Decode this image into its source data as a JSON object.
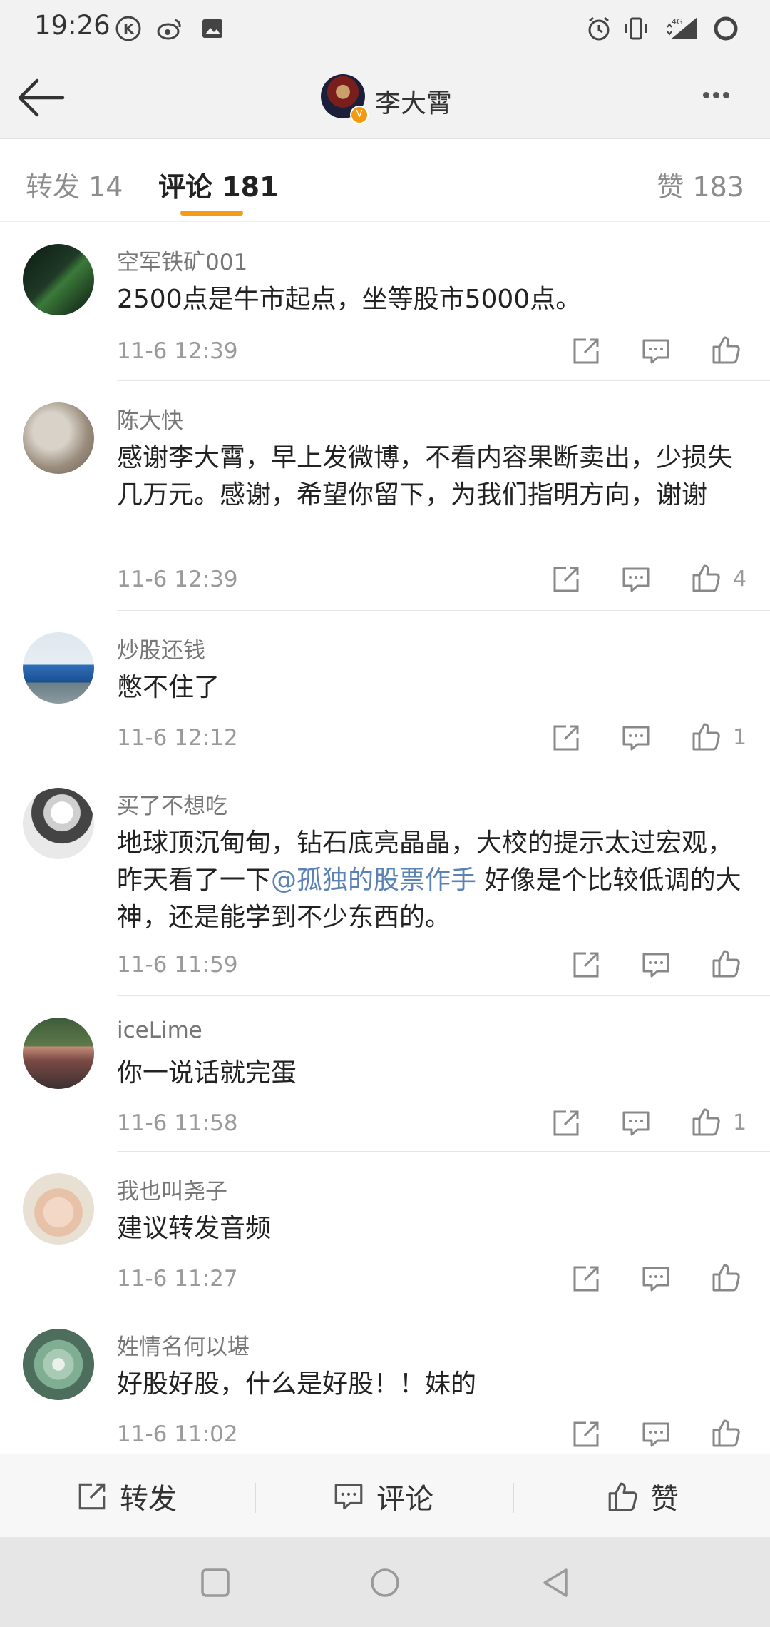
{
  "status_bar": {
    "time": "19:26",
    "network": "4G"
  },
  "header": {
    "title": "李大霄"
  },
  "tabs": [
    {
      "label": "转发 14"
    },
    {
      "label": "评论 181"
    },
    {
      "label": "赞 183"
    }
  ],
  "comments": [
    {
      "user": "空军铁矿001",
      "text": "2500点是牛市起点，坐等股市5000点。",
      "time": "11-6 12:39",
      "likes": ""
    },
    {
      "user": "陈大快",
      "text": "感谢李大霄，早上发微博，不看内容果断卖出，少损失几万元。感谢，希望你留下，为我们指明方向，谢谢",
      "time": "11-6 12:39",
      "likes": "4"
    },
    {
      "user": "炒股还钱",
      "text": "憋不住了",
      "time": "11-6 12:12",
      "likes": "1"
    },
    {
      "user": "买了不想吃",
      "text_before": "地球顶沉甸甸，钻石底亮晶晶，大校的提示太过宏观，昨天看了一下",
      "mention": "@孤独的股票作手",
      "text_after": " 好像是个比较低调的大神，还是能学到不少东西的。",
      "time": "11-6 11:59",
      "likes": ""
    },
    {
      "user": "iceLime",
      "text": "你一说话就完蛋",
      "time": "11-6 11:58",
      "likes": "1"
    },
    {
      "user": "我也叫尧子",
      "text": "建议转发音频",
      "time": "11-6 11:27",
      "likes": ""
    },
    {
      "user": "姓情名何以堪",
      "text": "好股好股，什么是好股！！妹的",
      "time": "11-6 11:02",
      "likes": ""
    }
  ],
  "bottom_bar": {
    "repost": "转发",
    "comment": "评论",
    "like": "赞"
  },
  "colors": {
    "accent": "#f59c16",
    "mention": "#5a82b5"
  }
}
